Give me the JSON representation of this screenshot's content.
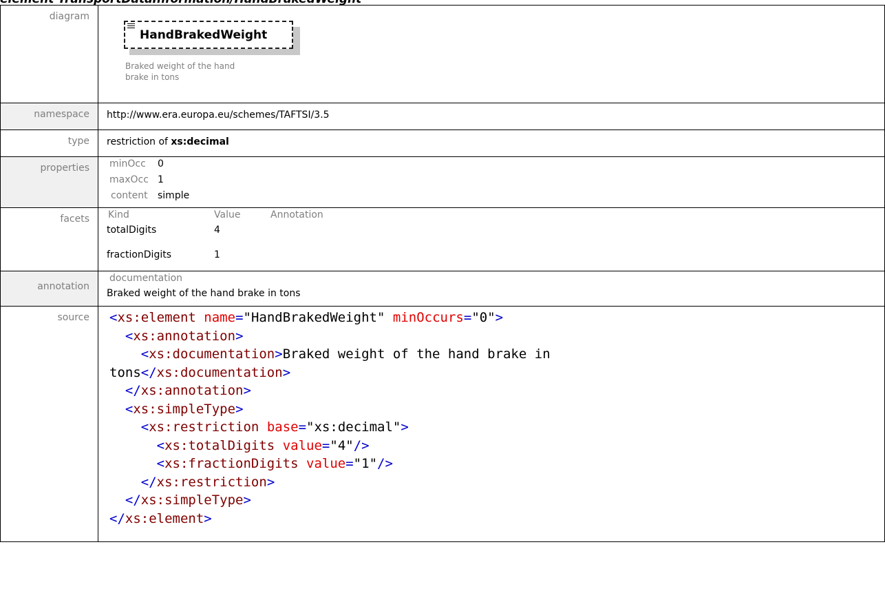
{
  "page_heading": "element TransportDataInformation/HandBrakedWeight",
  "labels": {
    "diagram": "diagram",
    "namespace": "namespace",
    "type": "type",
    "properties": "properties",
    "facets": "facets",
    "annotation": "annotation",
    "source": "source"
  },
  "diagram": {
    "element_name": "HandBrakedWeight",
    "description_line1": "Braked weight of the hand",
    "description_line2": "brake in tons"
  },
  "namespace": "http://www.era.europa.eu/schemes/TAFTSI/3.5",
  "type": {
    "prefix": "restriction of ",
    "base": "xs:decimal"
  },
  "properties": [
    {
      "key": "minOcc",
      "value": "0"
    },
    {
      "key": "maxOcc",
      "value": "1"
    },
    {
      "key": "content",
      "value": "simple"
    }
  ],
  "facets": {
    "headers": [
      "Kind",
      "Value",
      "Annotation"
    ],
    "rows": [
      {
        "kind": "totalDigits",
        "value": "4"
      },
      {
        "kind": "fractionDigits",
        "value": "1"
      }
    ]
  },
  "annotation": {
    "header": "documentation",
    "text": "Braked weight of the hand brake in tons"
  },
  "source": {
    "element_tag": "xs:element",
    "name_attr": "name",
    "name_val": "HandBrakedWeight",
    "minocc_attr": "minOccurs",
    "minocc_val": "0",
    "annotation_tag": "xs:annotation",
    "documentation_tag": "xs:documentation",
    "doc_line1": "Braked weight of the hand brake in",
    "doc_line2": "tons",
    "simpletype_tag": "xs:simpleType",
    "restriction_tag": "xs:restriction",
    "base_attr": "base",
    "base_val": "xs:decimal",
    "totaldigits_tag": "xs:totalDigits",
    "fractiondigits_tag": "xs:fractionDigits",
    "value_attr": "value",
    "totaldigits_val": "4",
    "fractiondigits_val": "1"
  }
}
